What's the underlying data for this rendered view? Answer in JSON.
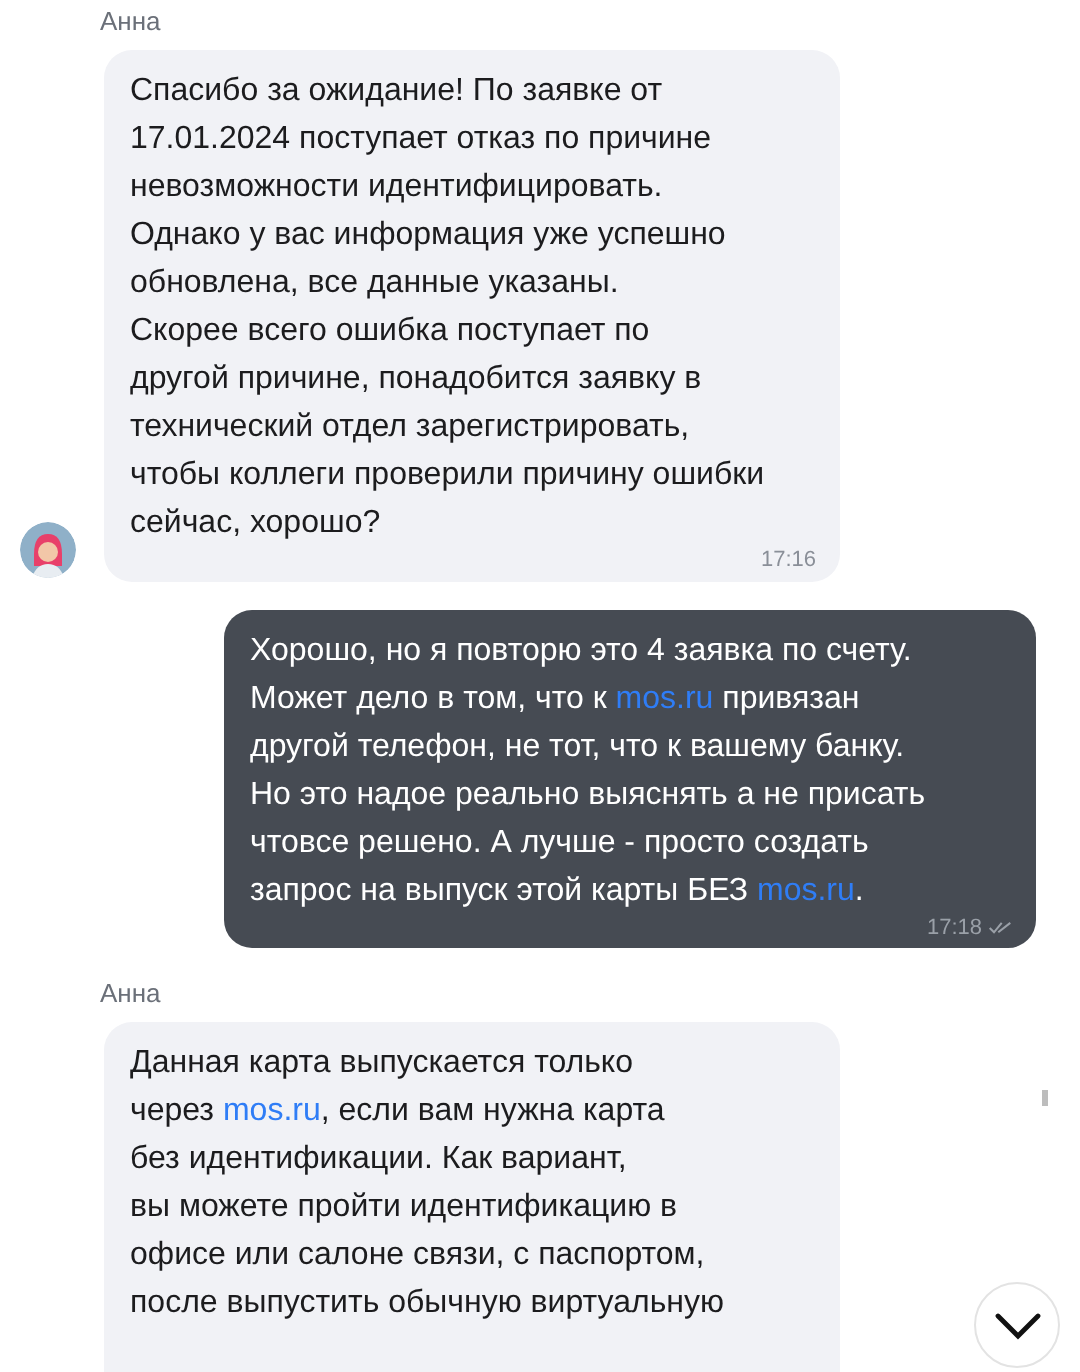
{
  "messages": [
    {
      "kind": "incoming",
      "sender": "Анна",
      "avatar": true,
      "time": "17:16",
      "parts": [
        {
          "kind": "text",
          "text": "Спасибо за ожидание! По заявке от\n17.01.2024 поступает отказ по причине\nневозможности идентифицировать.\nОднако у вас информация уже успешно\nобновлена, все данные указаны.\nСкорее всего ошибка поступает по\nдругой причине, понадобится заявку в\nтехнический отдел зарегистрировать,\nчтобы коллеги проверили причину ошибки\nсейчас, хорошо?"
        }
      ]
    },
    {
      "kind": "outgoing",
      "time": "17:18",
      "read": true,
      "parts": [
        {
          "kind": "text",
          "text": "Хорошо, но я повторю это 4 заявка по счету.\nМожет дело в том, что к "
        },
        {
          "kind": "link",
          "text": "mos.ru"
        },
        {
          "kind": "text",
          "text": " привязан\nдругой телефон, не тот, что к вашему банку.\nНо это надое реально выяснять а не присать\nчтовсе решено. А лучше - просто создать\nзапрос на выпуск этой карты БЕЗ "
        },
        {
          "kind": "link",
          "text": "mos.ru"
        },
        {
          "kind": "text",
          "text": "."
        }
      ]
    },
    {
      "kind": "incoming",
      "sender": "Анна",
      "avatar": false,
      "parts": [
        {
          "kind": "text",
          "text": "Данная карта выпускается только\nчерез "
        },
        {
          "kind": "link",
          "text": "mos.ru"
        },
        {
          "kind": "text",
          "text": ", если вам нужна карта\nбез идентификации. Как вариант,\nвы можете пройти идентификацию в\nофисе или салоне связи, с паспортом,\nпосле выпустить обычную виртуальную"
        }
      ]
    }
  ]
}
